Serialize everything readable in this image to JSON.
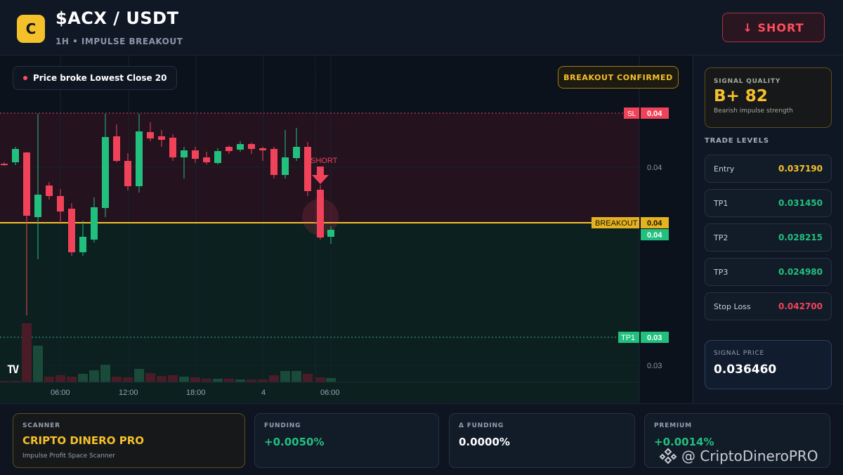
{
  "header": {
    "logo_letter": "C",
    "pair": "$ACX / USDT",
    "subtitle": "1H • IMPULSE BREAKOUT",
    "short_button": "↓ SHORT"
  },
  "chart": {
    "alert_text": "Price broke Lowest Close 20",
    "confirm_badge": "BREAKOUT CONFIRMED",
    "short_marker": "SHORT",
    "sl_tag": "SL",
    "sl_value": "0.04",
    "breakout_tag": "BREAKOUT",
    "breakout_value": "0.04",
    "last_price_value": "0.04",
    "tp1_tag": "TP1",
    "tp1_value": "0.03",
    "axis_label_upper": "0.04",
    "axis_label_lower": "0.03",
    "time_labels": [
      "06:00",
      "12:00",
      "18:00",
      "4",
      "06:00"
    ],
    "tv_logo": "TV",
    "colors": {
      "up": "#22c07e",
      "down": "#f0435a",
      "breakout": "#f5c12a"
    }
  },
  "side": {
    "quality_label": "SIGNAL QUALITY",
    "quality_grade": "B+ 82",
    "quality_desc": "Bearish impulse strength",
    "levels_title": "TRADE LEVELS",
    "levels": [
      {
        "name": "Entry",
        "value": "0.037190",
        "color": "#f5c12a"
      },
      {
        "name": "TP1",
        "value": "0.031450",
        "color": "#22c07e"
      },
      {
        "name": "TP2",
        "value": "0.028215",
        "color": "#22c07e"
      },
      {
        "name": "TP3",
        "value": "0.024980",
        "color": "#22c07e"
      },
      {
        "name": "Stop Loss",
        "value": "0.042700",
        "color": "#f0435a"
      }
    ],
    "signal_price_label": "SIGNAL PRICE",
    "signal_price": "0.036460"
  },
  "footer": {
    "scanner_label": "SCANNER",
    "scanner_name": "CRIPTO DINERO PRO",
    "scanner_sub": "Impulse Profit Space Scanner",
    "funding_label": "FUNDING",
    "funding_value": "+0.0050%",
    "dfunding_label": "Δ FUNDING",
    "dfunding_value": "0.0000%",
    "premium_label": "PREMIUM",
    "premium_value": "+0.0014%",
    "watermark": "@ CriptoDineroPRO"
  }
}
